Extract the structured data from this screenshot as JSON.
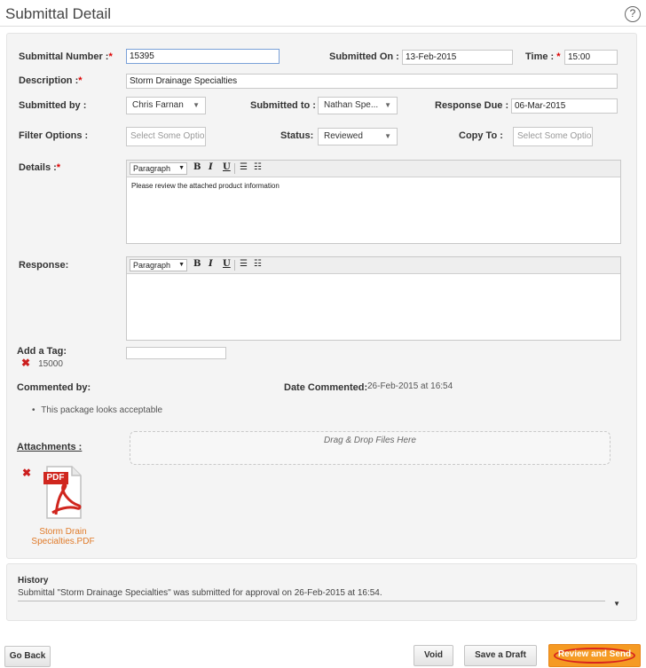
{
  "page": {
    "title": "Submittal Detail",
    "help_glyph": "?"
  },
  "form": {
    "submittal_number": {
      "label": "Submittal Number :",
      "required": "*",
      "value": "15395"
    },
    "submitted_on": {
      "label": "Submitted On :",
      "required": "*",
      "value": "13-Feb-2015"
    },
    "time": {
      "label": "Time :",
      "required": "*",
      "value": "15:00"
    },
    "description": {
      "label": "Description :",
      "required": "*",
      "value": "Storm Drainage Specialties"
    },
    "submitted_by": {
      "label": "Submitted by :",
      "value": "Chris Farnan"
    },
    "submitted_to": {
      "label": "Submitted to :",
      "value": "Nathan Spe..."
    },
    "response_due": {
      "label": "Response Due :",
      "value": "06-Mar-2015"
    },
    "filter_options": {
      "label": "Filter Options :",
      "placeholder": "Select Some Optio"
    },
    "status": {
      "label": "Status:",
      "value": "Reviewed"
    },
    "copy_to": {
      "label": "Copy To :",
      "placeholder": "Select Some Optio"
    },
    "details": {
      "label": "Details :",
      "required": "*",
      "paragraph": "Paragraph",
      "content": "Please review the attached product information"
    },
    "response": {
      "label": "Response:",
      "paragraph": "Paragraph",
      "content": ""
    },
    "toolbar": {
      "bold": "B",
      "italic": "I",
      "underline": "U",
      "bullet": "☰",
      "number": "☷"
    },
    "tags": {
      "label": "Add a Tag:",
      "items": [
        "15000"
      ],
      "input_value": ""
    },
    "commented_by": {
      "label": "Commented by:"
    },
    "date_commented": {
      "label": "Date Commented:",
      "value": "26-Feb-2015 at 16:54"
    },
    "comments": [
      "This package looks acceptable"
    ],
    "attachments": {
      "label": "Attachments :",
      "dropzone": "Drag & Drop Files Here",
      "files": [
        {
          "name_line1": "Storm Drain",
          "name_line2": "Specialties.PDF",
          "badge": "PDF"
        }
      ]
    }
  },
  "history": {
    "title": "History",
    "text": "Submittal \"Storm Drainage Specialties\" was submitted for approval on 26-Feb-2015 at 16:54."
  },
  "actions": {
    "go_back": "Go Back",
    "void": "Void",
    "save_draft": "Save a Draft",
    "review_send": "Review and Send"
  },
  "colors": {
    "accent": "#f59a23",
    "danger": "#cc1f1f",
    "link": "#e07b2a"
  }
}
